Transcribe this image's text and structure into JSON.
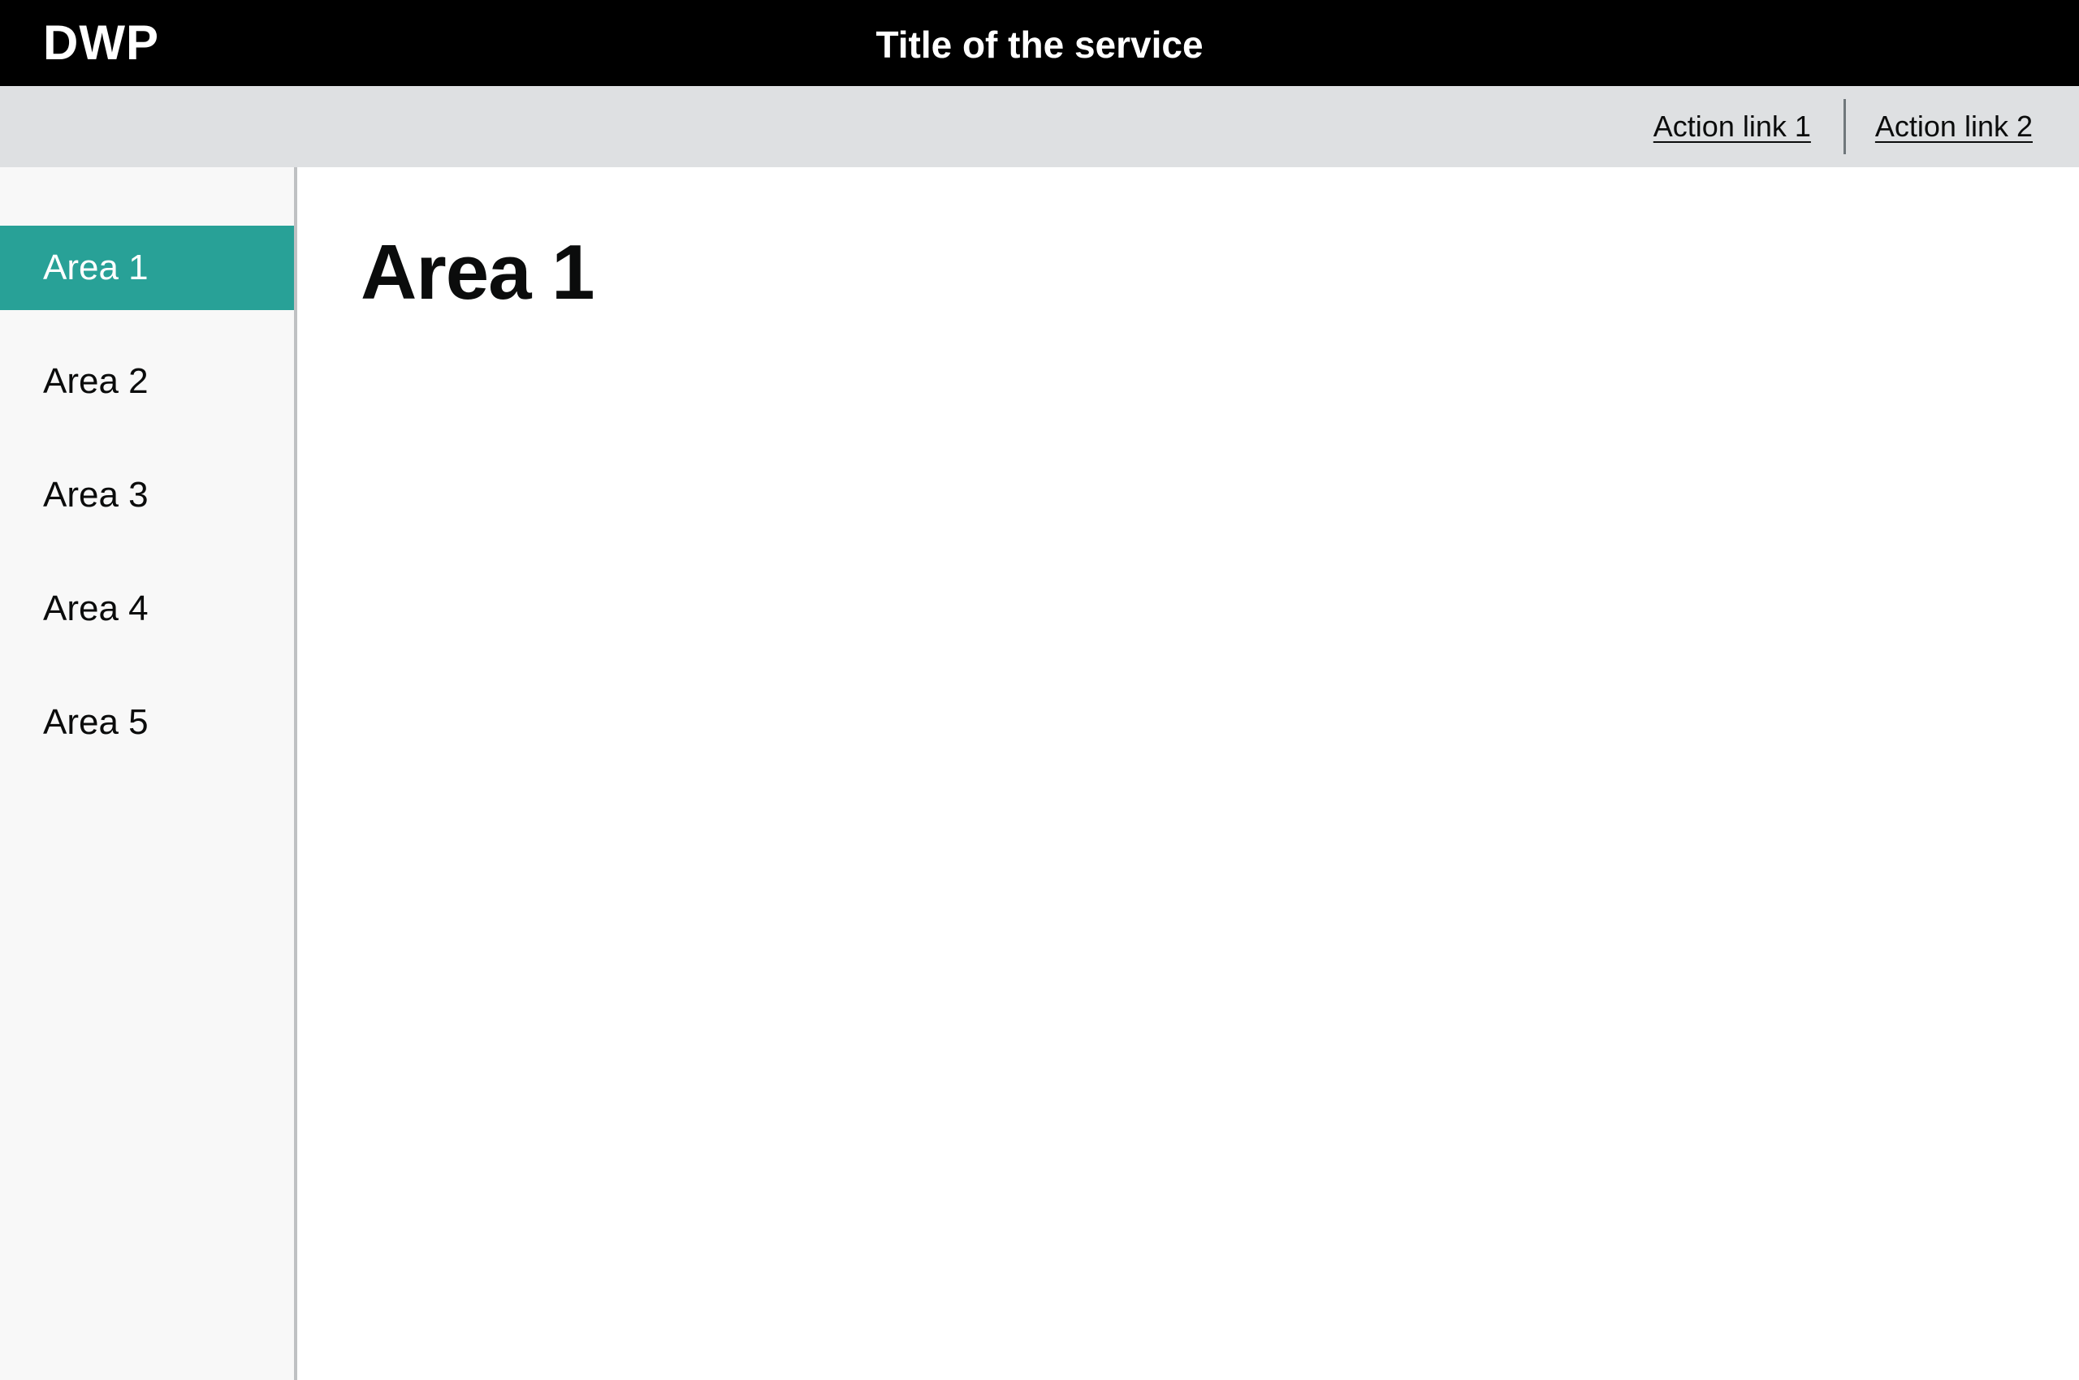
{
  "header": {
    "logo": "DWP",
    "service_title": "Title of the service",
    "background": "#000000"
  },
  "action_bar": {
    "links": [
      {
        "label": "Action link 1"
      },
      {
        "label": "Action link 2"
      }
    ],
    "background": "#dee0e2"
  },
  "sidebar": {
    "items": [
      {
        "label": "Area 1",
        "active": true
      },
      {
        "label": "Area 2",
        "active": false
      },
      {
        "label": "Area 3",
        "active": false
      },
      {
        "label": "Area 4",
        "active": false
      },
      {
        "label": "Area 5",
        "active": false
      }
    ],
    "active_color": "#28a197",
    "background": "#f8f8f8"
  },
  "main": {
    "title": "Area 1"
  }
}
